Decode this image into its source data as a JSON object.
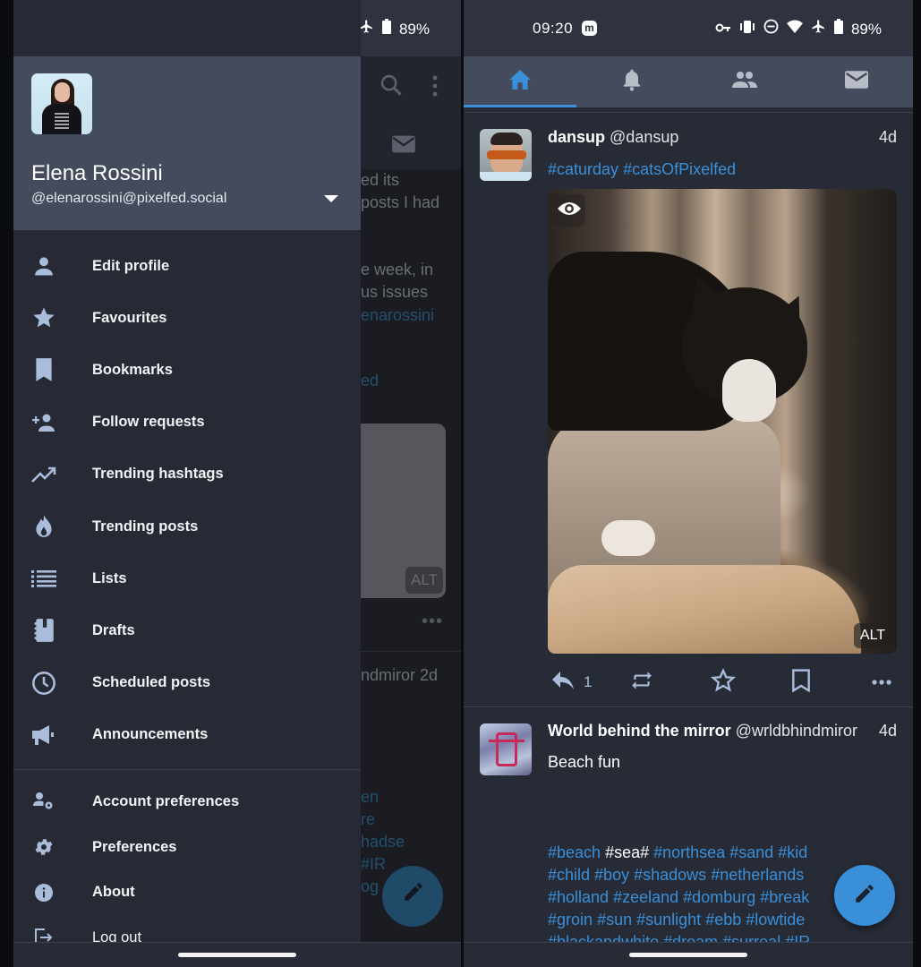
{
  "status_bar": {
    "time": "09:20",
    "app_notification_icon": "mastodon-icon",
    "battery": "89%",
    "icons": [
      "vpn-key-icon",
      "vibrate-icon",
      "do-not-disturb-icon",
      "wifi-icon",
      "airplane-mode-icon",
      "battery-icon"
    ]
  },
  "left_screen": {
    "drawer": {
      "profile": {
        "name": "Elena Rossini",
        "handle": "@elenarossini@pixelfed.social"
      },
      "menu_items": [
        {
          "label": "Edit profile",
          "icon": "person-icon"
        },
        {
          "label": "Favourites",
          "icon": "star-icon"
        },
        {
          "label": "Bookmarks",
          "icon": "bookmark-icon"
        },
        {
          "label": "Follow requests",
          "icon": "person-add-icon"
        },
        {
          "label": "Trending hashtags",
          "icon": "trending-up-icon"
        },
        {
          "label": "Trending posts",
          "icon": "flame-icon"
        },
        {
          "label": "Lists",
          "icon": "list-icon"
        },
        {
          "label": "Drafts",
          "icon": "notebook-icon"
        },
        {
          "label": "Scheduled posts",
          "icon": "clock-icon"
        },
        {
          "label": "Announcements",
          "icon": "megaphone-icon"
        }
      ],
      "secondary_items": [
        {
          "label": "Account preferences",
          "icon": "account-settings-icon"
        },
        {
          "label": "Preferences",
          "icon": "gear-icon"
        },
        {
          "label": "About",
          "icon": "info-icon"
        },
        {
          "label": "Log out",
          "icon": "logout-icon"
        }
      ]
    },
    "background_feed": {
      "text_fragments": [
        "ed its",
        "posts I had",
        "e week, in",
        "us issues",
        "enarossini",
        "ed",
        "ndmiror  2d",
        "en",
        "re",
        "hadse",
        "#IR",
        "og"
      ],
      "alt_label": "ALT",
      "more_label": "•••"
    }
  },
  "right_screen": {
    "tabs": [
      {
        "name": "home",
        "icon": "home-icon",
        "active": true
      },
      {
        "name": "notifications",
        "icon": "bell-icon",
        "active": false
      },
      {
        "name": "local",
        "icon": "people-icon",
        "active": false
      },
      {
        "name": "direct-messages",
        "icon": "mail-icon",
        "active": false
      }
    ],
    "posts": [
      {
        "display_name": "dansup",
        "handle": "@dansup",
        "time": "4d",
        "hashtags": [
          "#caturday",
          "#catsOfPixelfed"
        ],
        "media_alt_label": "ALT",
        "replies": "1"
      },
      {
        "display_name": "World behind the mirror",
        "handle": "@wrldbhindmiror",
        "time": "4d",
        "text": "Beach fun",
        "hashtag_lines": [
          [
            {
              "t": "#beach",
              "link": true
            },
            {
              "t": "#sea#",
              "link": false
            },
            {
              "t": "#northsea",
              "link": true
            },
            {
              "t": "#sand",
              "link": true
            },
            {
              "t": "#kid",
              "link": true
            }
          ],
          [
            {
              "t": "#child",
              "link": true
            },
            {
              "t": "#boy",
              "link": true
            },
            {
              "t": "#shadows",
              "link": true
            },
            {
              "t": "#netherlands",
              "link": true
            }
          ],
          [
            {
              "t": "#holland",
              "link": true
            },
            {
              "t": "#zeeland",
              "link": true
            },
            {
              "t": "#domburg",
              "link": true
            },
            {
              "t": "#break",
              "link": true
            }
          ],
          [
            {
              "t": "#groin",
              "link": true
            },
            {
              "t": "#sun",
              "link": true
            },
            {
              "t": "#sunlight",
              "link": true
            },
            {
              "t": "#ebb",
              "link": true
            },
            {
              "t": "#lowtide",
              "link": true
            }
          ],
          [
            {
              "t": "#blackandwhite",
              "link": true
            },
            {
              "t": "#dream",
              "link": true
            },
            {
              "t": "#surreal",
              "link": true
            },
            {
              "t": "#IR",
              "link": true
            }
          ]
        ]
      }
    ]
  },
  "colors": {
    "accent": "#3a8fd9",
    "drawer_bg": "#272a35",
    "header_bg": "#444b5c",
    "icon_tint": "#a9bddb"
  }
}
